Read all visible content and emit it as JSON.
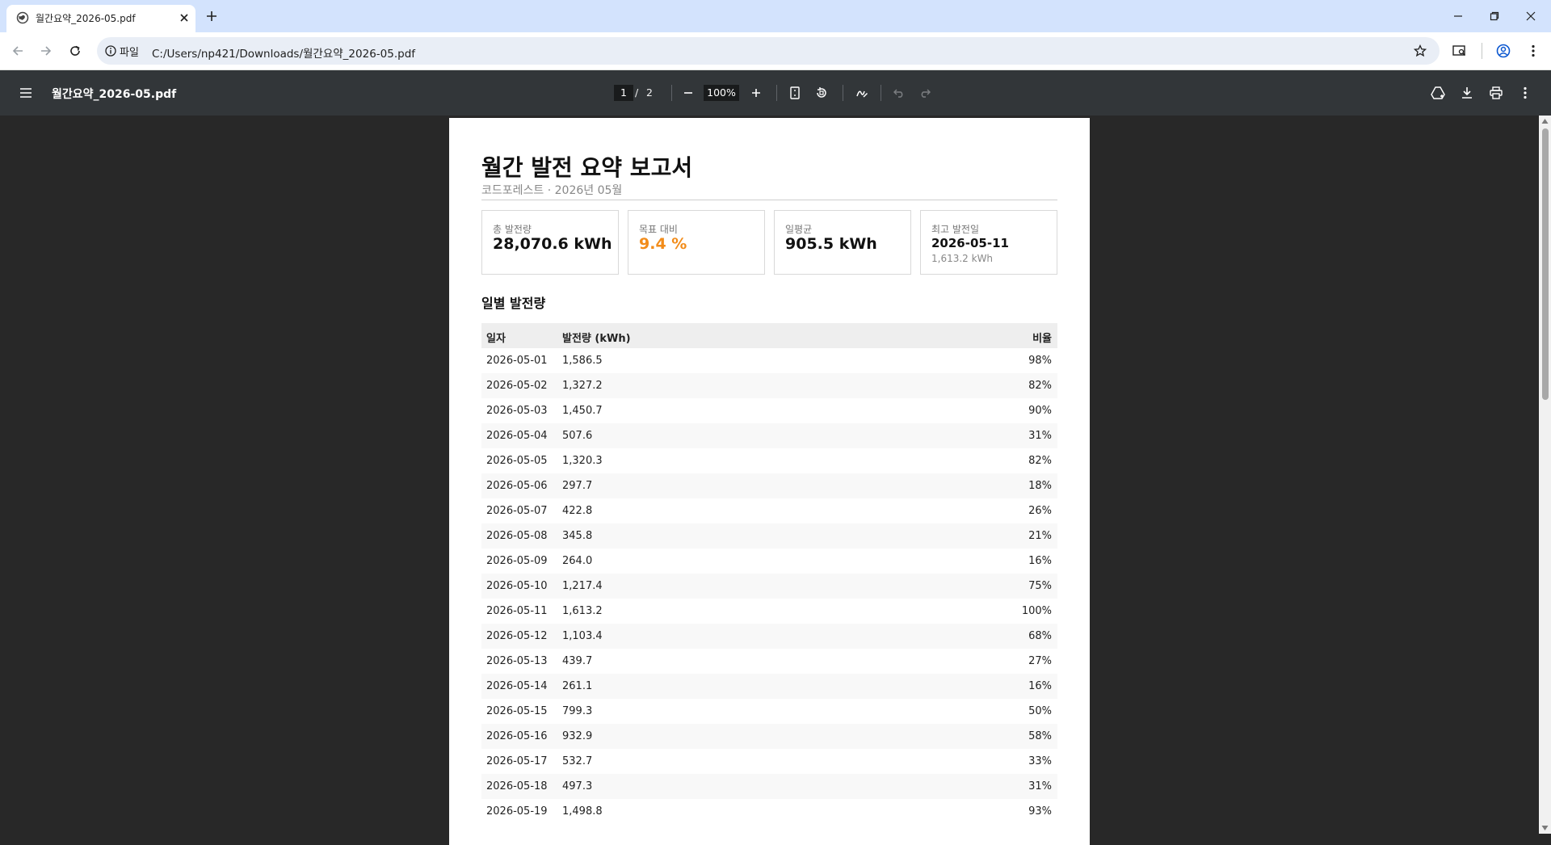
{
  "browser": {
    "tab_title": "월간요약_2026-05.pdf",
    "site_chip": "파일",
    "url": "C:/Users/np421/Downloads/월간요약_2026-05.pdf"
  },
  "pdf_toolbar": {
    "title": "월간요약_2026-05.pdf",
    "current_page": "1",
    "page_sep": "/",
    "total_pages": "2",
    "zoom": "100%"
  },
  "document": {
    "title": "월간 발전 요약 보고서",
    "subtitle": "코드포레스트  ·  2026년 05월",
    "cards": [
      {
        "label": "총 발전량",
        "value": "28,070.6 kWh"
      },
      {
        "label": "목표 대비",
        "value": "9.4 %",
        "color": "#f28c1a"
      },
      {
        "label": "일평균",
        "value": "905.5 kWh"
      },
      {
        "label": "최고 발전일",
        "value": "2026-05-11",
        "sub": "1,613.2 kWh"
      }
    ],
    "section_title": "일별 발전량",
    "table": {
      "headers": [
        "일자",
        "발전량 (kWh)",
        "비율"
      ],
      "rows": [
        [
          "2026-05-01",
          "1,586.5",
          "98%"
        ],
        [
          "2026-05-02",
          "1,327.2",
          "82%"
        ],
        [
          "2026-05-03",
          "1,450.7",
          "90%"
        ],
        [
          "2026-05-04",
          "507.6",
          "31%"
        ],
        [
          "2026-05-05",
          "1,320.3",
          "82%"
        ],
        [
          "2026-05-06",
          "297.7",
          "18%"
        ],
        [
          "2026-05-07",
          "422.8",
          "26%"
        ],
        [
          "2026-05-08",
          "345.8",
          "21%"
        ],
        [
          "2026-05-09",
          "264.0",
          "16%"
        ],
        [
          "2026-05-10",
          "1,217.4",
          "75%"
        ],
        [
          "2026-05-11",
          "1,613.2",
          "100%"
        ],
        [
          "2026-05-12",
          "1,103.4",
          "68%"
        ],
        [
          "2026-05-13",
          "439.7",
          "27%"
        ],
        [
          "2026-05-14",
          "261.1",
          "16%"
        ],
        [
          "2026-05-15",
          "799.3",
          "50%"
        ],
        [
          "2026-05-16",
          "932.9",
          "58%"
        ],
        [
          "2026-05-17",
          "532.7",
          "33%"
        ],
        [
          "2026-05-18",
          "497.3",
          "31%"
        ],
        [
          "2026-05-19",
          "1,498.8",
          "93%"
        ]
      ]
    }
  }
}
